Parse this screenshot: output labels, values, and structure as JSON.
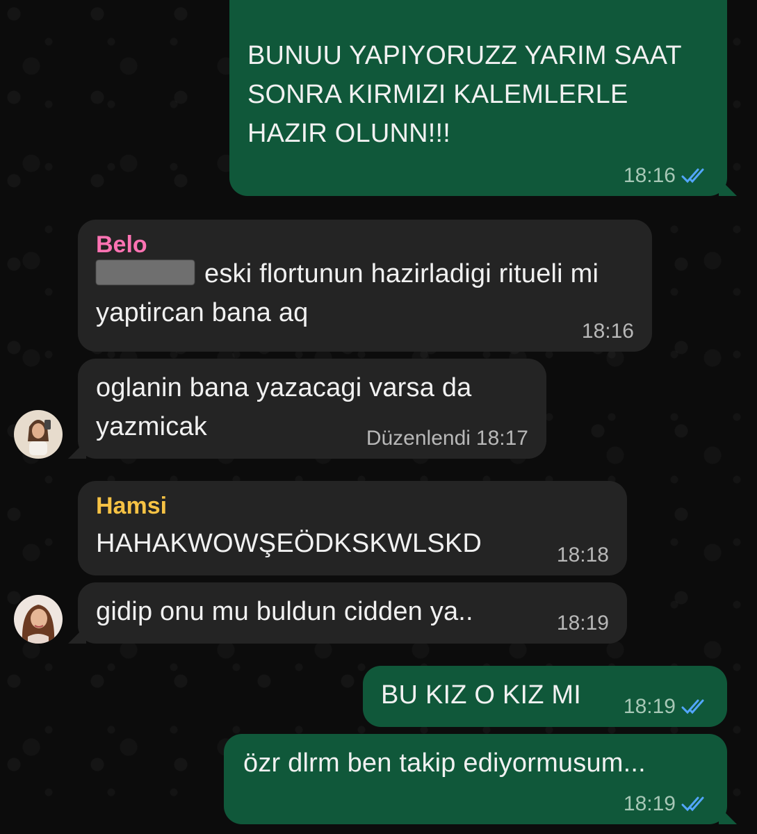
{
  "messages": {
    "m1": {
      "text": "BUNUU YAPIYORUZZ YARIM SAAT SONRA KIRMIZI KALEMLERLE HAZIR OLUNN!!!",
      "time": "18:16",
      "status": "read"
    },
    "m2": {
      "sender": "Belo",
      "sender_color": "#ff73b3",
      "text": "eski flortunun hazirladigi ritueli mi yaptircan bana aq",
      "time": "18:16"
    },
    "m3": {
      "text": "oglanin bana yazacagi varsa da yazmicak",
      "edited_label": "Düzenlendi",
      "time": "18:17"
    },
    "m4": {
      "sender": "Hamsi",
      "sender_color": "#f6c244",
      "text": "HAHAKWOWŞEÖDKSKWLSKD",
      "time": "18:18"
    },
    "m5": {
      "text": "gidip onu mu buldun cidden ya..",
      "time": "18:19"
    },
    "m6": {
      "text": "BU KIZ O KIZ MI",
      "time": "18:19",
      "status": "read"
    },
    "m7": {
      "text": "özr dlrm ben takip ediyormusum...",
      "time": "18:19",
      "status": "read"
    }
  },
  "icons": {
    "read_receipt": "double-check-icon",
    "avatars": [
      "contact-avatar",
      "contact-avatar"
    ]
  },
  "colors": {
    "outgoing_bubble": "#10583a",
    "incoming_bubble": "#242424",
    "read_check": "#53a6ff"
  }
}
